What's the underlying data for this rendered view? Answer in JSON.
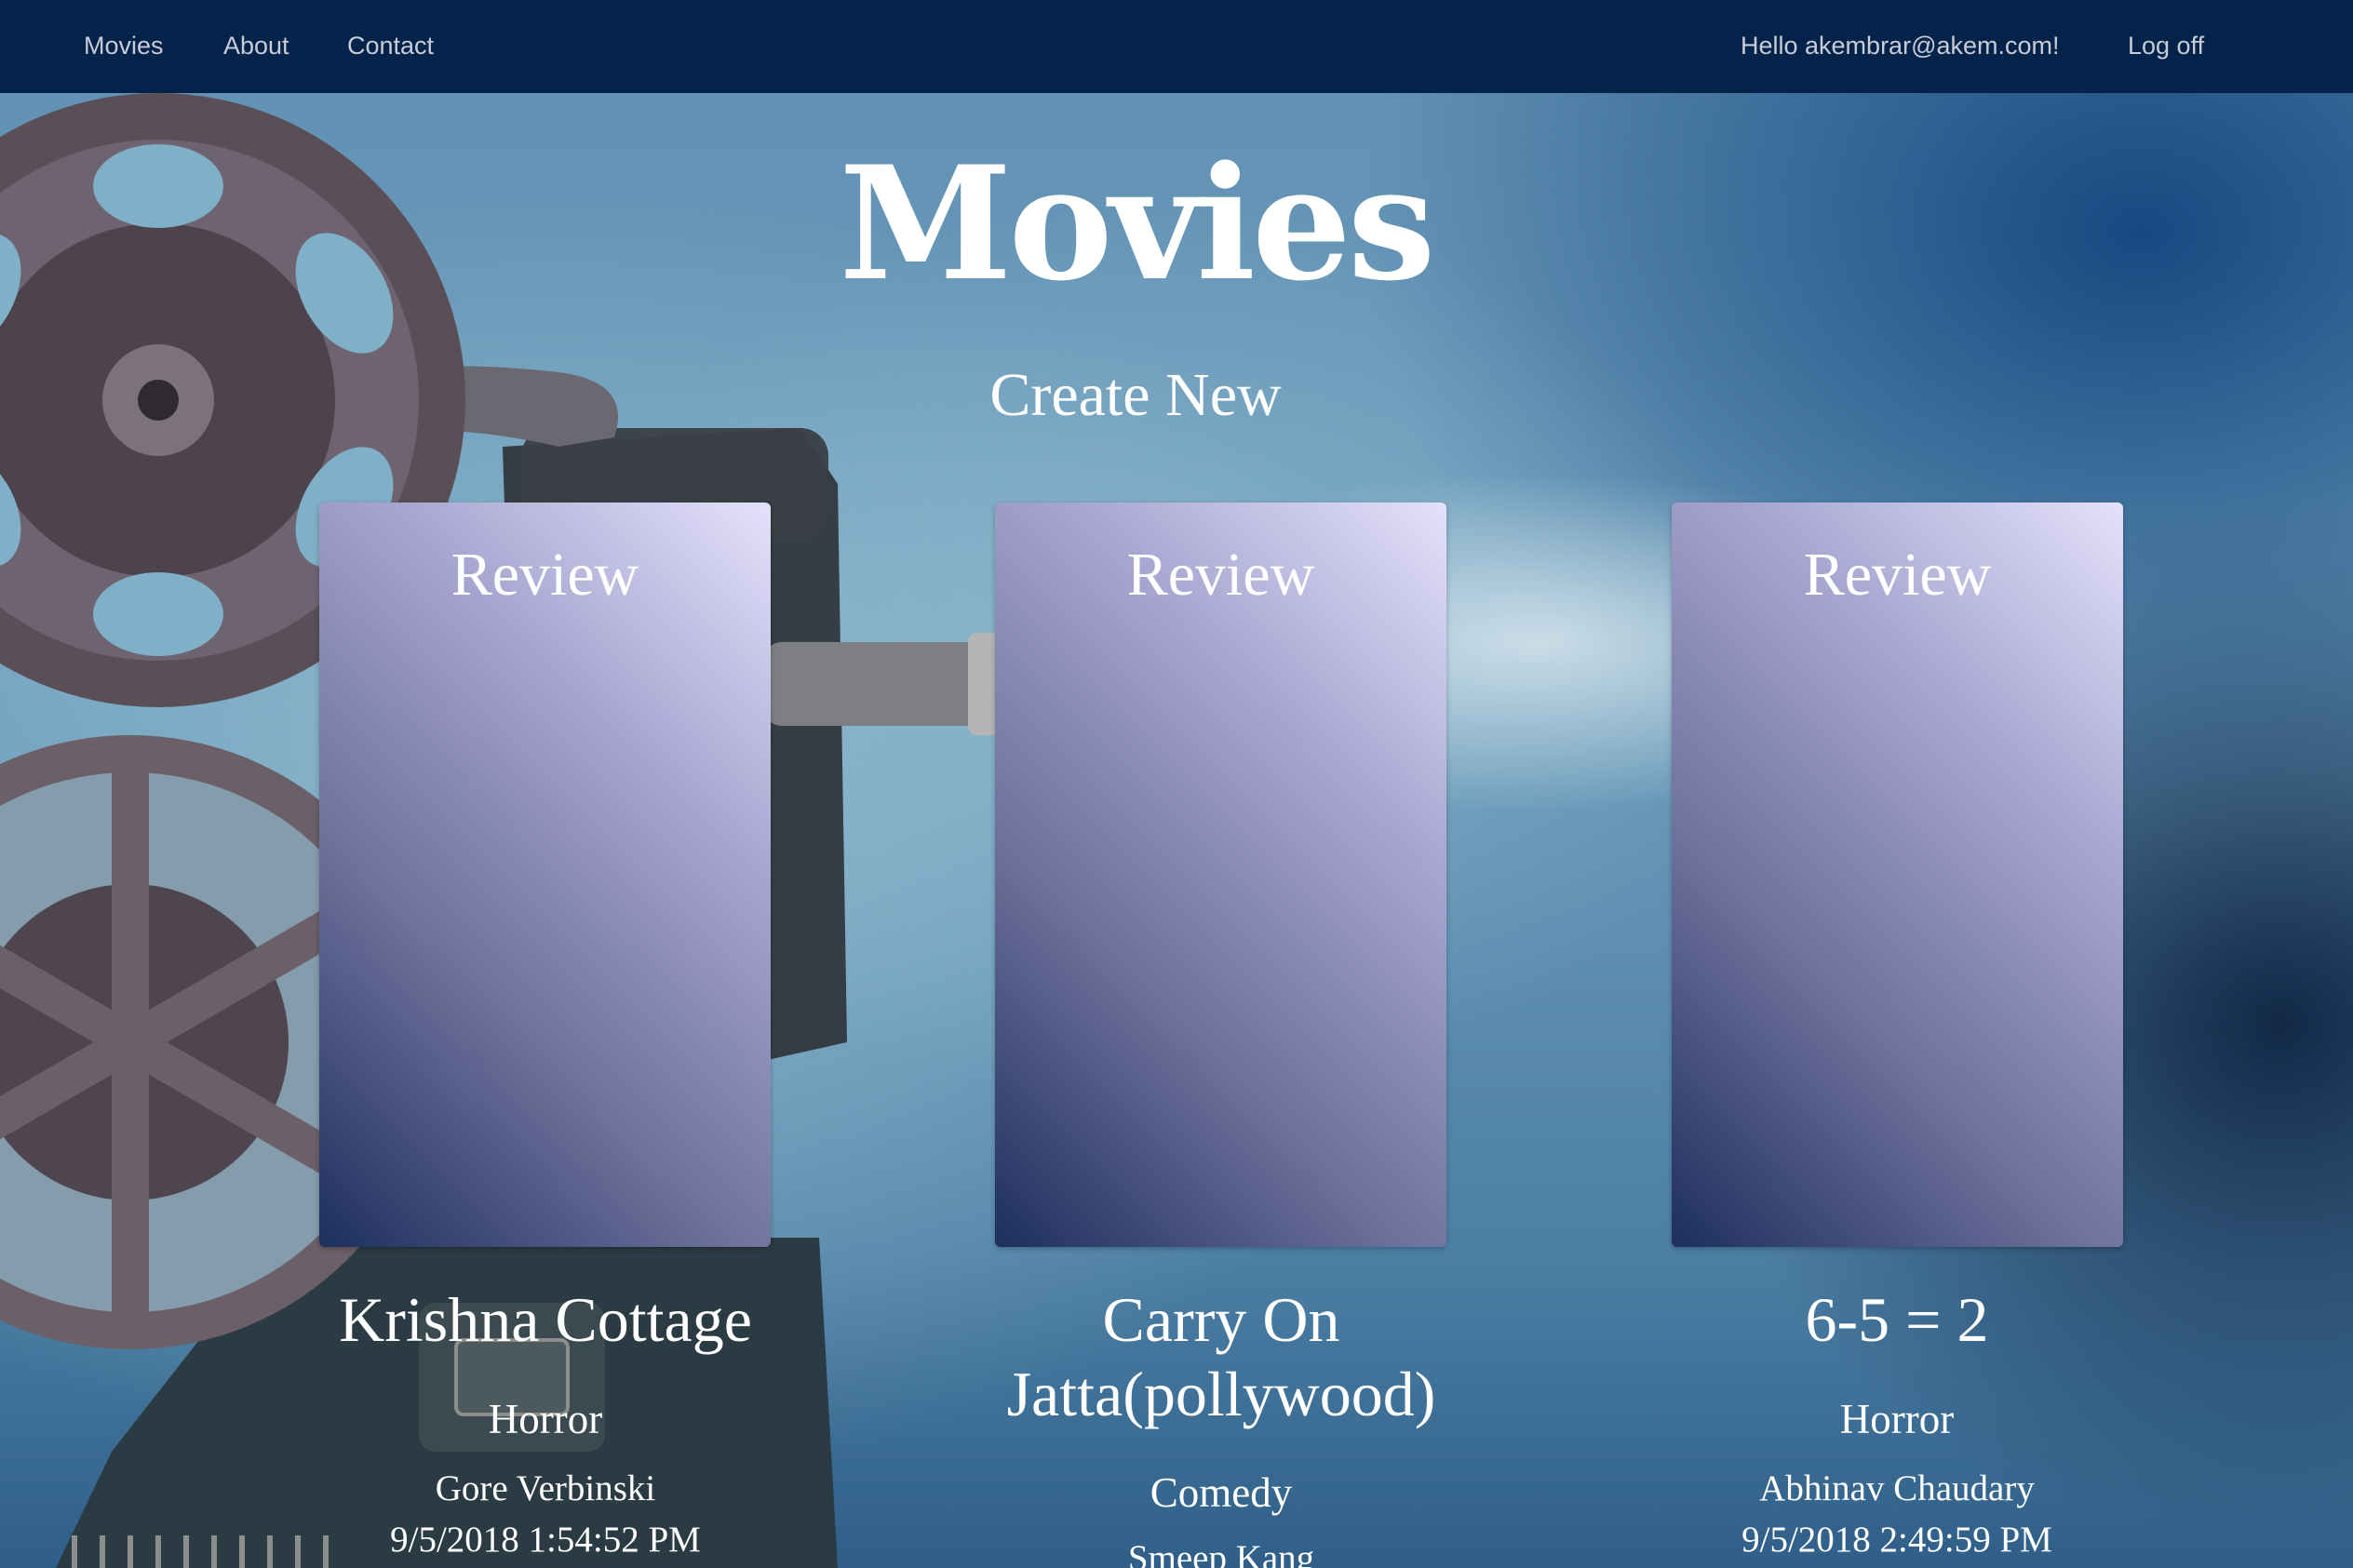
{
  "nav": {
    "links": [
      "Movies",
      "About",
      "Contact"
    ],
    "greeting": "Hello akembrar@akem.com!",
    "logoff": "Log off"
  },
  "page": {
    "title": "Movies",
    "create_new": "Create New"
  },
  "movies": [
    {
      "review_label": "Review",
      "title": "Krishna Cottage",
      "genre": "Horror",
      "director": "Gore Verbinski",
      "date": "9/5/2018 1:54:52 PM"
    },
    {
      "review_label": "Review",
      "title": "Carry On Jatta(pollywood)",
      "genre": "Comedy",
      "director": "Smeep Kang",
      "date": ""
    },
    {
      "review_label": "Review",
      "title": "6-5 = 2",
      "genre": "Horror",
      "director": "Abhinav Chaudary",
      "date": "9/5/2018 2:49:59 PM"
    }
  ],
  "colors": {
    "navbar": "#03234a",
    "nav_text": "#c8ccd6",
    "card_light": "#e4e1fb",
    "card_dark": "#1d2f5d"
  }
}
